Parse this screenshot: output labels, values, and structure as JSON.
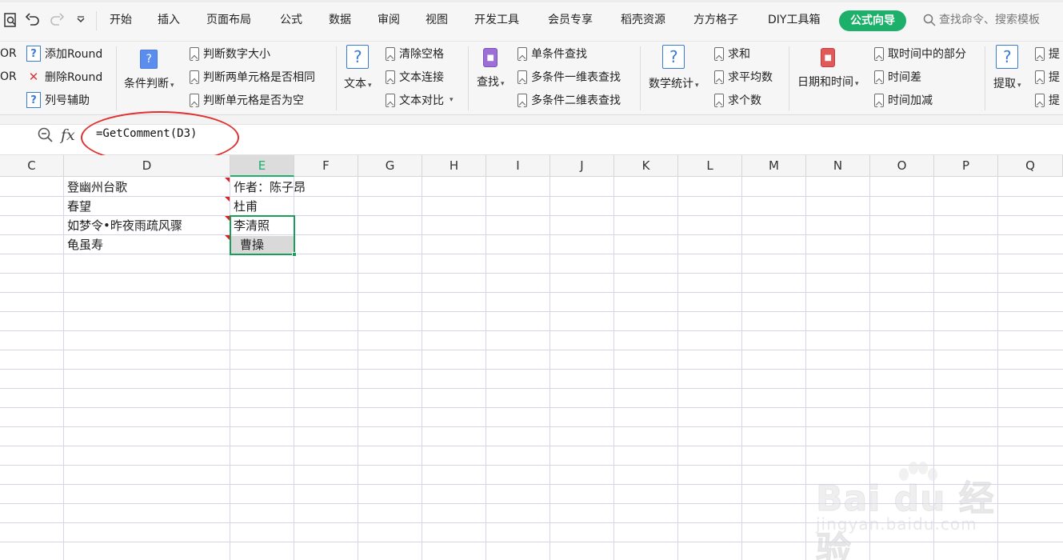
{
  "menubar": {
    "tabs": [
      "开始",
      "插入",
      "页面布局",
      "公式",
      "数据",
      "审阅",
      "视图",
      "开发工具",
      "会员专享",
      "稻壳资源",
      "方方格子",
      "DIY工具箱"
    ],
    "active_tab": "公式向导",
    "search_placeholder": "查找命令、搜索模板"
  },
  "ribbon": {
    "group1": {
      "row1_prefix": "OR",
      "row2_prefix": "OR",
      "add_round": "添加Round",
      "delete_round": "删除Round",
      "col_helper": "列号辅助"
    },
    "group2": {
      "big_label": "条件判断",
      "items": [
        "判断数字大小",
        "判断两单元格是否相同",
        "判断单元格是否为空"
      ]
    },
    "group3": {
      "big_label": "文本",
      "items": [
        "清除空格",
        "文本连接",
        "文本对比"
      ]
    },
    "group4": {
      "big_label": "查找",
      "items": [
        "单条件查找",
        "多条件一维表查找",
        "多条件二维表查找"
      ]
    },
    "group5": {
      "big_label": "数学统计",
      "items": [
        "求和",
        "求平均数",
        "求个数"
      ]
    },
    "group6": {
      "big_label": "日期和时间",
      "items": [
        "取时间中的部分",
        "时间差",
        "时间加减"
      ]
    },
    "group7": {
      "big_label": "提取",
      "items": [
        "提",
        "提",
        "提"
      ]
    }
  },
  "formula_bar": {
    "fx_label": "fx",
    "formula": "=GetComment(D3)"
  },
  "sheet": {
    "columns": [
      "C",
      "D",
      "E",
      "F",
      "G",
      "H",
      "I",
      "J",
      "K",
      "L",
      "M",
      "N",
      "O",
      "P",
      "Q"
    ],
    "selected_column": "E",
    "rows": [
      {
        "d": "登幽州台歌",
        "e": "作者：陈子昂"
      },
      {
        "d": "春望",
        "e": "杜甫"
      },
      {
        "d": "如梦令•昨夜雨疏风骤",
        "e": "李清照"
      },
      {
        "d": "龟虽寿",
        "e": "曹操"
      }
    ]
  },
  "watermark": {
    "main": "Bai du 经验",
    "sub": "jingyan.baidu.com"
  }
}
